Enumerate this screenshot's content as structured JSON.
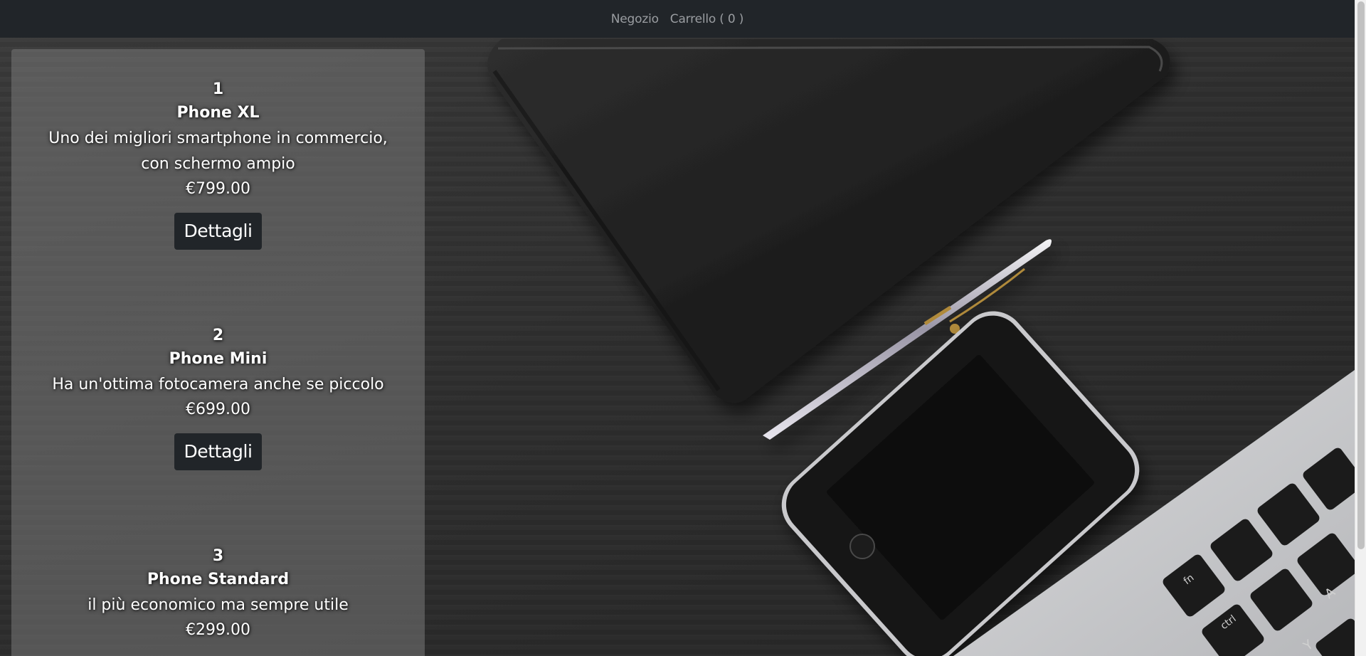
{
  "nav": {
    "shop_label": "Negozio",
    "cart_label": "Carrello ( 0 )"
  },
  "products": [
    {
      "id": "1",
      "name": "Phone XL",
      "description": "Uno dei migliori smartphone in commercio, con schermo ampio",
      "price": "€799.00",
      "button_label": "Dettagli"
    },
    {
      "id": "2",
      "name": "Phone Mini",
      "description": "Ha un'ottima fotocamera anche se piccolo",
      "price": "€699.00",
      "button_label": "Dettagli"
    },
    {
      "id": "3",
      "name": "Phone Standard",
      "description": "il più economico ma sempre utile",
      "price": "€299.00"
    }
  ],
  "colors": {
    "navbar": "#212529",
    "button": "#212529",
    "panel": "rgba(120,120,120,0.55)"
  },
  "background_image": "desk-with-notebook-pen-smartphone-laptop",
  "laptop_keys": [
    "fn",
    "ctrl",
    "A",
    "Y"
  ]
}
